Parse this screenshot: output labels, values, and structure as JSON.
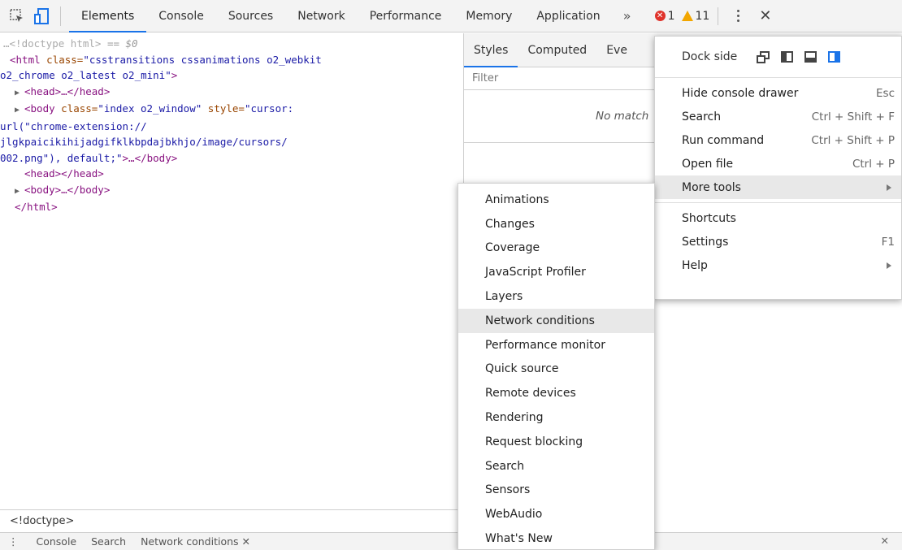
{
  "toolbar": {
    "tabs": [
      "Elements",
      "Console",
      "Sources",
      "Network",
      "Performance",
      "Memory",
      "Application"
    ],
    "more": "»",
    "errors": "1",
    "warnings": "11",
    "close": "✕",
    "icons": [
      "inspect-element-icon",
      "device-toolbar-icon",
      "error-icon",
      "warning-icon",
      "kebab-menu-icon",
      "close-icon"
    ]
  },
  "dom": {
    "line1_prefix": "…",
    "line1_doctype": "<!doctype html>",
    "line1_suffix": " == $0",
    "line2_tag_open": "<html",
    "line2_attr": " class=",
    "line2_val": "\"csstransitions cssanimations o2_webkit",
    "line3_val": "o2_chrome o2_latest o2_mini\"",
    "line3_close": ">",
    "line4": "<head>…</head>",
    "line5_tag": "<body",
    "line5_attr1": " class=",
    "line5_val1": "\"index o2_window\"",
    "line5_attr2": " style=",
    "line5_val2": "\"cursor:",
    "line6_val": "url(\"chrome-extension://",
    "line7_val": "jlgkpaicikihijadgifklkbpdajbkhjo/image/cursors/",
    "line8_val": "002.png\"), default;\"",
    "line8_close": ">…</body>",
    "line9": "<head></head>",
    "line10": "<body>…</body>",
    "line11": "</html>"
  },
  "breadcrumb": "<!doctype>",
  "drawer": {
    "tabs": [
      "Console",
      "Search",
      "Network conditions ✕"
    ],
    "close": "✕"
  },
  "styles": {
    "tabs": [
      "Styles",
      "Computed",
      "Eve"
    ],
    "filter_placeholder": "Filter",
    "no_match": "No match"
  },
  "menu": {
    "dock_label": "Dock side",
    "items_group1": [
      {
        "label": "Hide console drawer",
        "shortcut": "Esc"
      },
      {
        "label": "Search",
        "shortcut": "Ctrl + Shift + F"
      },
      {
        "label": "Run command",
        "shortcut": "Ctrl + Shift + P"
      },
      {
        "label": "Open file",
        "shortcut": "Ctrl + P"
      },
      {
        "label": "More tools",
        "shortcut": ""
      }
    ],
    "items_group2": [
      {
        "label": "Shortcuts",
        "shortcut": ""
      },
      {
        "label": "Settings",
        "shortcut": "F1"
      },
      {
        "label": "Help",
        "shortcut": ""
      }
    ]
  },
  "submenu": {
    "items": [
      "Animations",
      "Changes",
      "Coverage",
      "JavaScript Profiler",
      "Layers",
      "Network conditions",
      "Performance monitor",
      "Quick source",
      "Remote devices",
      "Rendering",
      "Request blocking",
      "Search",
      "Sensors",
      "WebAudio",
      "What's New"
    ],
    "highlighted": "Network conditions"
  },
  "colors": {
    "accent": "#1a73e8",
    "error": "#e0332b",
    "warning": "#f2a600",
    "dock_selected": "#1a73e8"
  }
}
